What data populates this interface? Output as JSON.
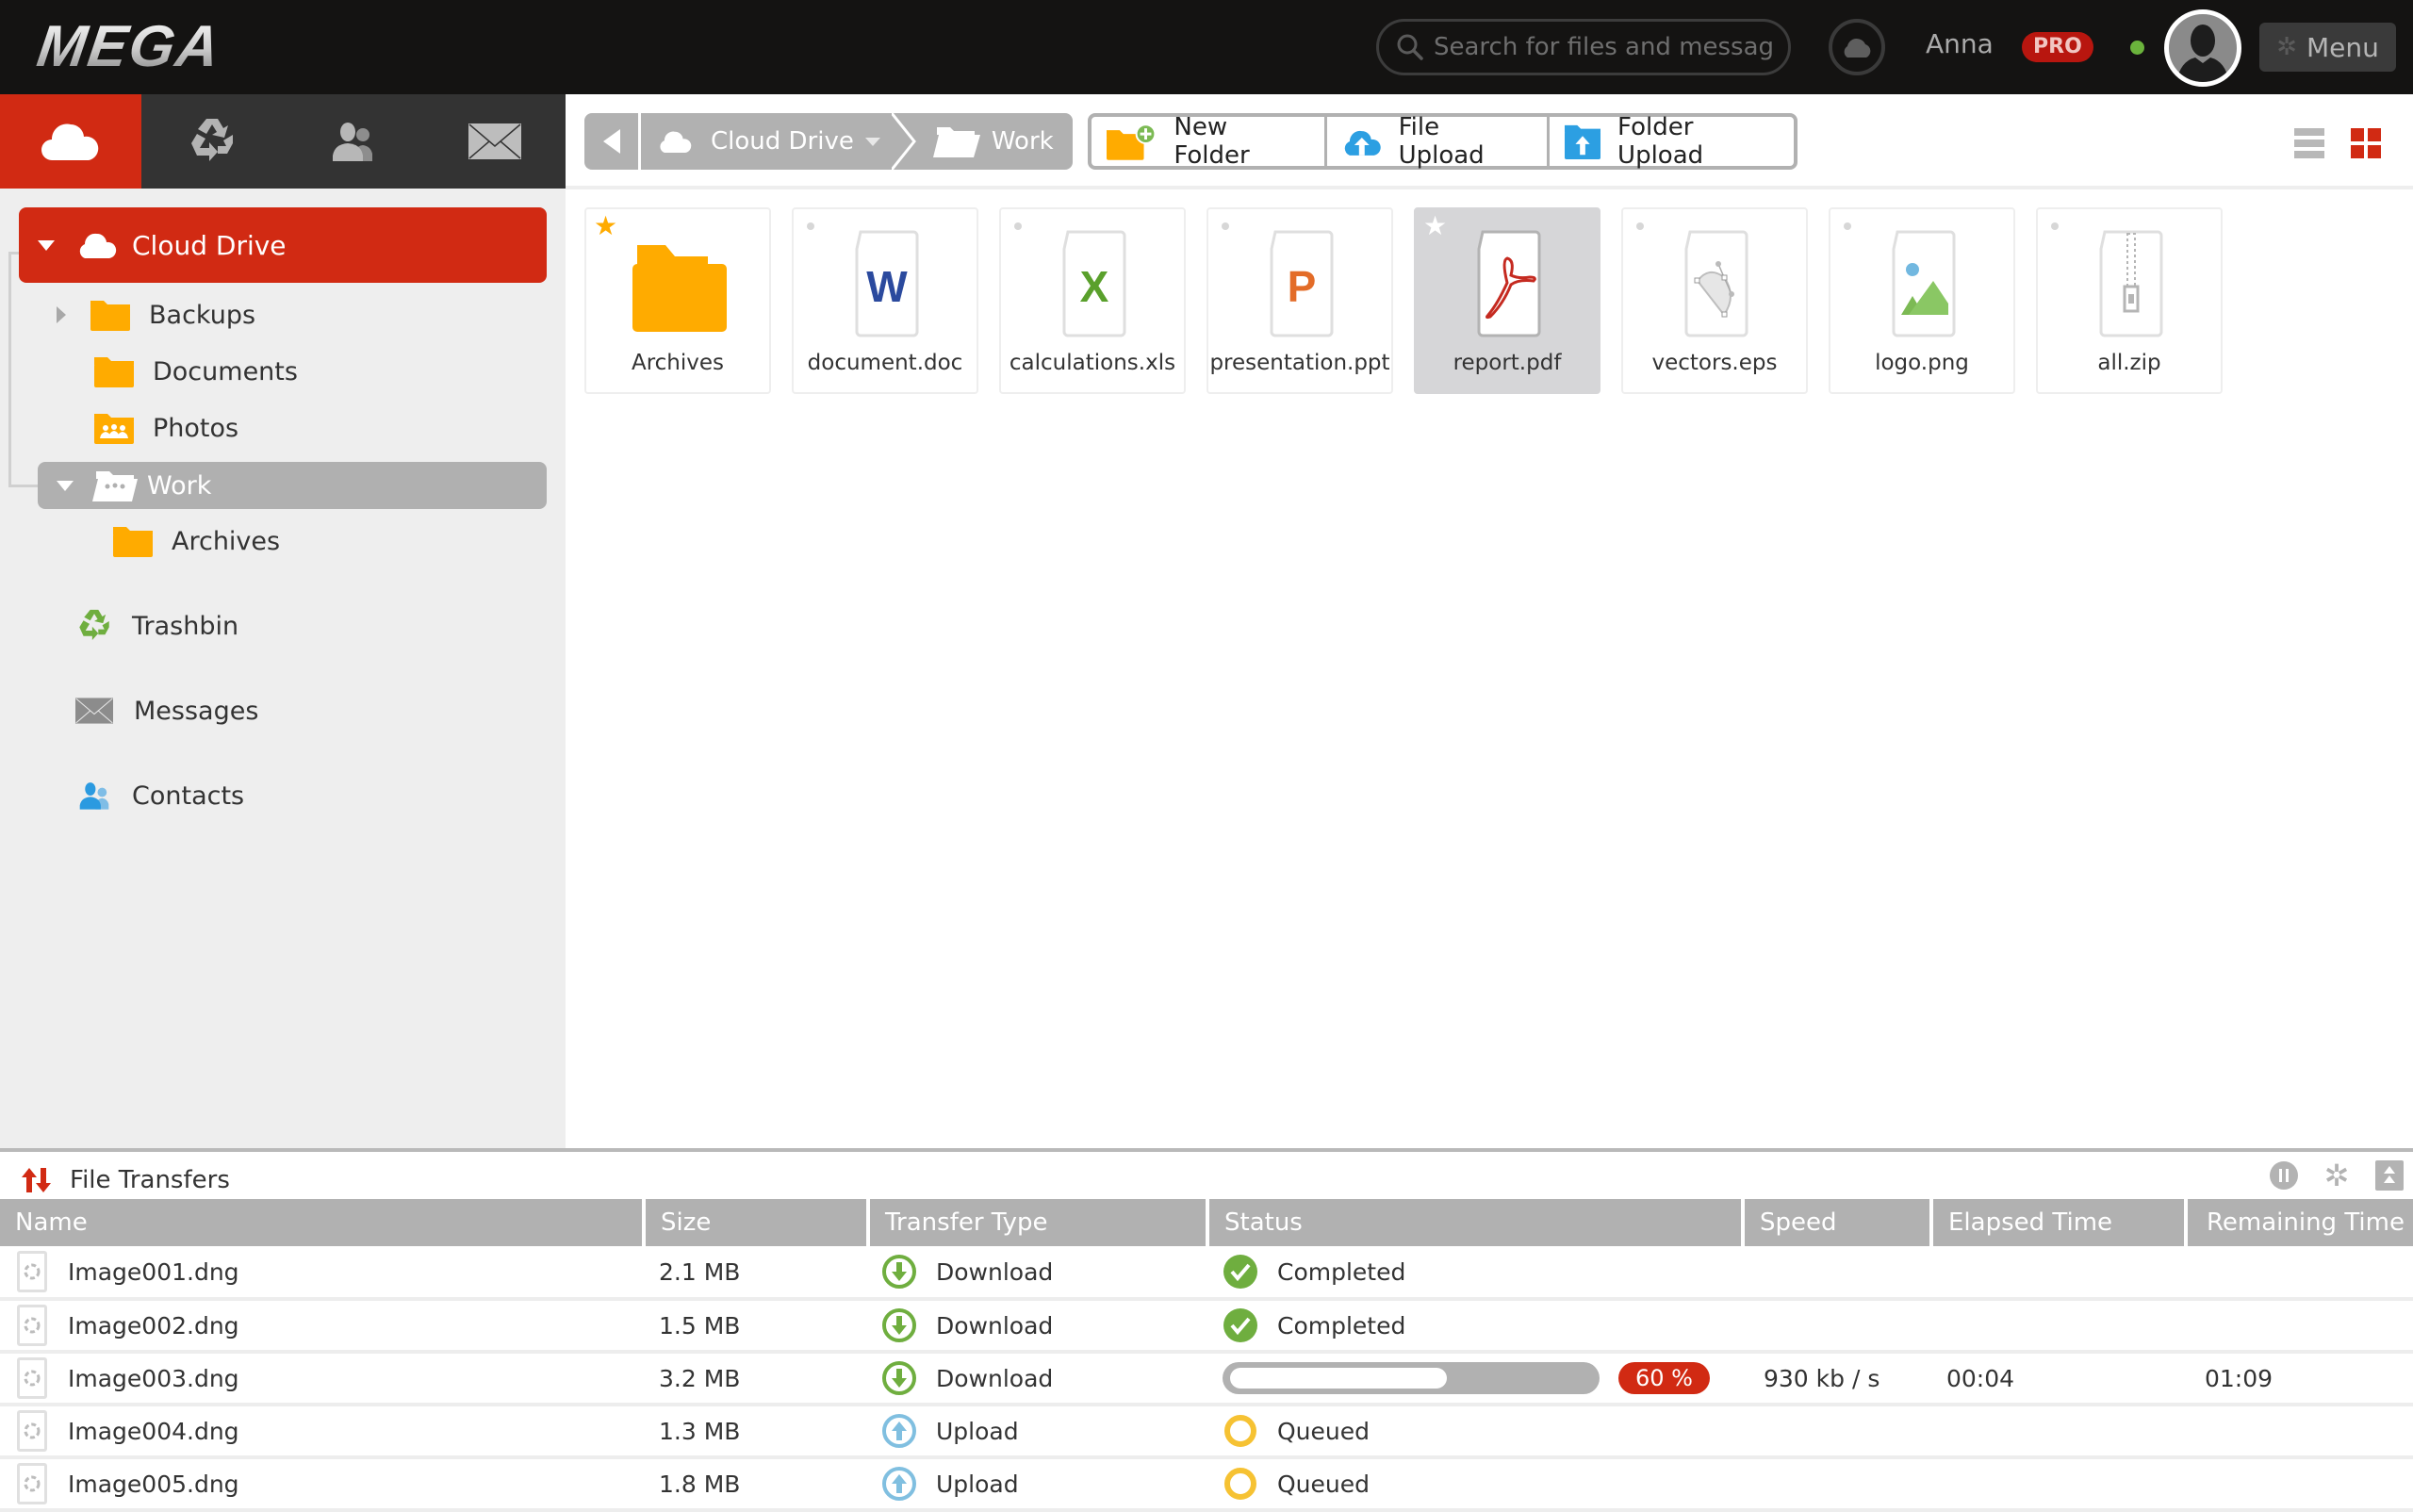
{
  "header": {
    "logo": "MEGA",
    "search_placeholder": "Search for files and messages",
    "username": "Anna",
    "badge": "PRO",
    "menu_label": "Menu",
    "colors": {
      "brand": "#d12a13",
      "online": "#6bb33c"
    }
  },
  "section_tabs": [
    {
      "name": "cloud-drive",
      "icon": "cloud-icon",
      "active": true
    },
    {
      "name": "trashbin",
      "icon": "recycle-icon",
      "active": false
    },
    {
      "name": "contacts",
      "icon": "contacts-icon",
      "active": false
    },
    {
      "name": "messages",
      "icon": "envelope-icon",
      "active": false
    }
  ],
  "sidebar": {
    "tree": {
      "root": {
        "label": "Cloud Drive",
        "expanded": true
      },
      "children": [
        {
          "label": "Backups",
          "icon": "folder-icon",
          "expandable": true
        },
        {
          "label": "Documents",
          "icon": "folder-icon"
        },
        {
          "label": "Photos",
          "icon": "shared-folder-icon"
        },
        {
          "label": "Work",
          "icon": "shared-folder-icon",
          "expanded": true,
          "selected": true,
          "children": [
            {
              "label": "Archives",
              "icon": "folder-icon"
            }
          ]
        }
      ]
    },
    "nav": [
      {
        "label": "Trashbin",
        "icon": "recycle-icon"
      },
      {
        "label": "Messages",
        "icon": "envelope-icon"
      },
      {
        "label": "Contacts",
        "icon": "contacts-icon"
      }
    ]
  },
  "breadcrumb": {
    "items": [
      {
        "label": "Cloud Drive",
        "icon": "cloud-icon",
        "dropdown": true
      },
      {
        "label": "Work",
        "icon": "folder-open-icon"
      }
    ]
  },
  "actions": {
    "new_folder": "New Folder",
    "file_upload": "File Upload",
    "folder_upload": "Folder Upload"
  },
  "view": {
    "active": "grid"
  },
  "files": [
    {
      "name": "Archives",
      "type": "folder",
      "starred": true
    },
    {
      "name": "document.doc",
      "type": "word"
    },
    {
      "name": "calculations.xls",
      "type": "excel"
    },
    {
      "name": "presentation.ppt",
      "type": "powerpoint"
    },
    {
      "name": "report.pdf",
      "type": "pdf",
      "starred": true,
      "selected": true
    },
    {
      "name": "vectors.eps",
      "type": "vector"
    },
    {
      "name": "logo.png",
      "type": "image"
    },
    {
      "name": "all.zip",
      "type": "archive"
    }
  ],
  "transfers": {
    "title": "File Transfers",
    "columns": [
      "Name",
      "Size",
      "Transfer Type",
      "Status",
      "Speed",
      "Elapsed Time",
      "Remaining Time"
    ],
    "rows": [
      {
        "name": "Image001.dng",
        "size": "2.1 MB",
        "type": "Download",
        "status": "Completed",
        "speed": "",
        "elapsed": "",
        "remaining": ""
      },
      {
        "name": "Image002.dng",
        "size": "1.5 MB",
        "type": "Download",
        "status": "Completed",
        "speed": "",
        "elapsed": "",
        "remaining": ""
      },
      {
        "name": "Image003.dng",
        "size": "3.2 MB",
        "type": "Download",
        "status": "In progress",
        "progress": 60,
        "progress_label": "60 %",
        "speed": "930 kb / s",
        "elapsed": "00:04",
        "remaining": "01:09"
      },
      {
        "name": "Image004.dng",
        "size": "1.3 MB",
        "type": "Upload",
        "status": "Queued",
        "speed": "",
        "elapsed": "",
        "remaining": ""
      },
      {
        "name": "Image005.dng",
        "size": "1.8 MB",
        "type": "Upload",
        "status": "Queued",
        "speed": "",
        "elapsed": "",
        "remaining": ""
      }
    ]
  }
}
